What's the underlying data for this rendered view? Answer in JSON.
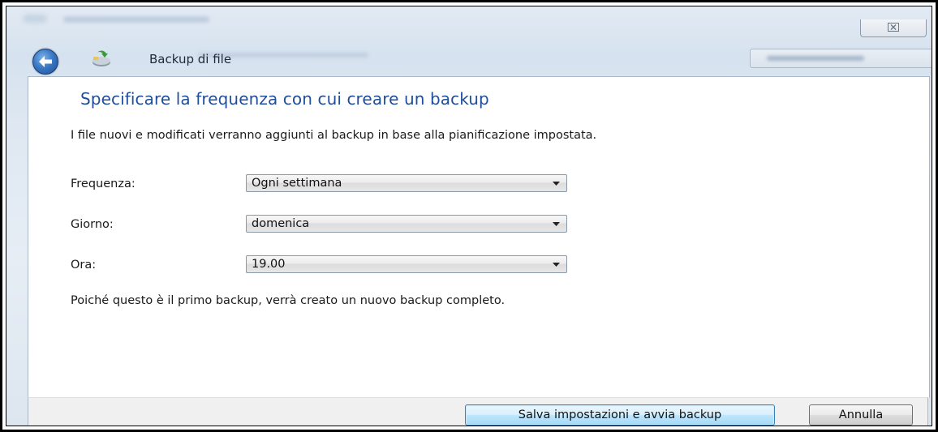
{
  "window": {
    "close_glyph": "☒",
    "nav_title": "Backup di file"
  },
  "icons": {
    "back": "back-arrow-icon",
    "app": "backup-icon",
    "close": "close-icon",
    "dropdown": "chevron-down-icon"
  },
  "content": {
    "heading": "Specificare la frequenza con cui creare un backup",
    "description": "I file nuovi e modificati verranno aggiunti al backup in base alla pianificazione impostata.",
    "fields": [
      {
        "label": "Frequenza:",
        "value": "Ogni settimana"
      },
      {
        "label": "Giorno:",
        "value": "domenica"
      },
      {
        "label": "Ora:",
        "value": "19.00"
      }
    ],
    "info": "Poiché questo è il primo backup, verrà creato un nuovo backup completo."
  },
  "footer": {
    "primary_label": "Salva impostazioni e avvia backup",
    "cancel_label": "Annulla"
  },
  "colors": {
    "heading": "#1e4e9c",
    "primary_button_border": "#3c7fb1"
  }
}
